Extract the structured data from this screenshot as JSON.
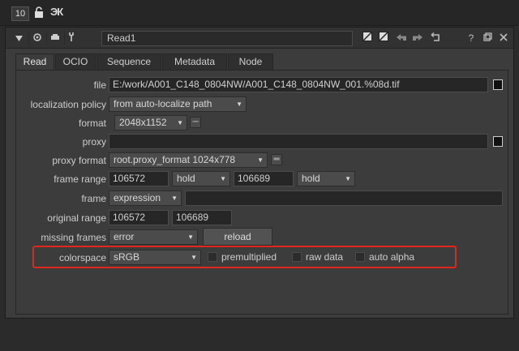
{
  "topbar": {
    "number": "10",
    "logo": "ЭК"
  },
  "titlebar": {
    "node_name": "Read1"
  },
  "tabs": [
    "Read",
    "OCIO",
    "Sequence",
    "Metadata",
    "Node"
  ],
  "form": {
    "file": {
      "label": "file",
      "value": "E:/work/A001_C148_0804NW/A001_C148_0804NW_001.%08d.tif"
    },
    "localization_policy": {
      "label": "localization policy",
      "value": "from auto-localize path"
    },
    "format": {
      "label": "format",
      "value": "2048x1152"
    },
    "proxy": {
      "label": "proxy",
      "value": ""
    },
    "proxy_format": {
      "label": "proxy format",
      "value": "root.proxy_format 1024x778"
    },
    "frame_range": {
      "label": "frame range",
      "start": "106572",
      "start_mode": "hold",
      "end": "106689",
      "end_mode": "hold"
    },
    "frame": {
      "label": "frame",
      "mode": "expression",
      "value": ""
    },
    "original_range": {
      "label": "original range",
      "start": "106572",
      "end": "106689"
    },
    "missing_frames": {
      "label": "missing frames",
      "value": "error",
      "reload": "reload"
    },
    "colorspace": {
      "label": "colorspace",
      "value": "sRGB",
      "premultiplied": "premultiplied",
      "raw_data": "raw data",
      "auto_alpha": "auto alpha"
    }
  },
  "colors": {
    "highlight": "#e2261b"
  }
}
